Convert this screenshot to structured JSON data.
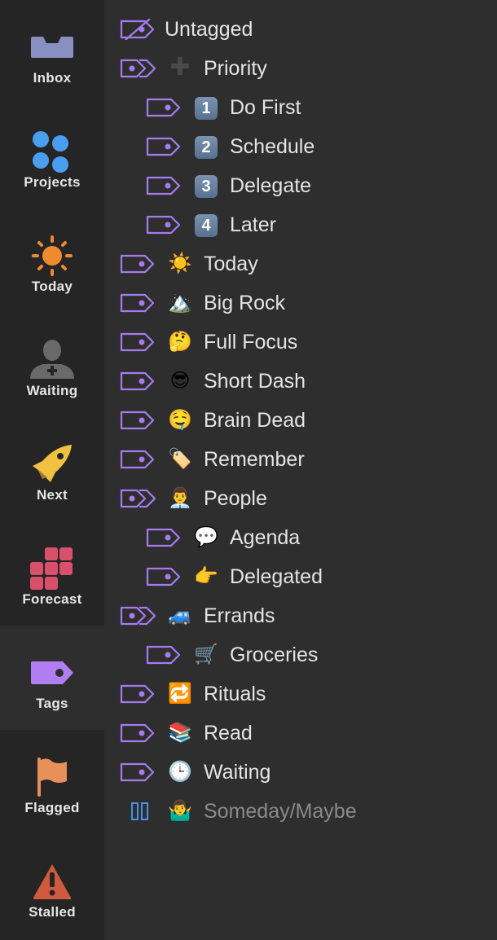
{
  "sidebar": {
    "items": [
      {
        "label": "Inbox",
        "icon": "inbox-icon",
        "color": "#8a8fc2"
      },
      {
        "label": "Projects",
        "icon": "projects-icon",
        "color": "#4a9ef0"
      },
      {
        "label": "Today",
        "icon": "sun-icon",
        "color": "#f08a30"
      },
      {
        "label": "Waiting",
        "icon": "person-plus-icon",
        "color": "#6a6a6a"
      },
      {
        "label": "Next",
        "icon": "rocket-icon",
        "color": "#f0c040"
      },
      {
        "label": "Forecast",
        "icon": "forecast-grid-icon",
        "color": "#d8506a"
      },
      {
        "label": "Tags",
        "icon": "tag-icon",
        "color": "#b07ef0",
        "selected": true
      },
      {
        "label": "Flagged",
        "icon": "flag-icon",
        "color": "#e8905a"
      },
      {
        "label": "Stalled",
        "icon": "warning-icon",
        "color": "#d05a40"
      }
    ]
  },
  "tags": {
    "accent": "#a77bf0",
    "dropped_color": "#4a8fe8",
    "items": [
      {
        "label": "Untagged",
        "emoji": "",
        "level": 0,
        "kind": "untagged"
      },
      {
        "label": "Priority",
        "emoji": "➕",
        "level": 0,
        "kind": "group"
      },
      {
        "label": "Do First",
        "emoji": "1",
        "level": 1,
        "kind": "tag",
        "keycap": true
      },
      {
        "label": "Schedule",
        "emoji": "2",
        "level": 1,
        "kind": "tag",
        "keycap": true
      },
      {
        "label": "Delegate",
        "emoji": "3",
        "level": 1,
        "kind": "tag",
        "keycap": true
      },
      {
        "label": "Later",
        "emoji": "4",
        "level": 1,
        "kind": "tag",
        "keycap": true
      },
      {
        "label": "Today",
        "emoji": "☀️",
        "level": 0,
        "kind": "tag"
      },
      {
        "label": "Big Rock",
        "emoji": "🏔️",
        "level": 0,
        "kind": "tag"
      },
      {
        "label": "Full Focus",
        "emoji": "🤔",
        "level": 0,
        "kind": "tag"
      },
      {
        "label": "Short Dash",
        "emoji": "😎",
        "level": 0,
        "kind": "tag"
      },
      {
        "label": "Brain Dead",
        "emoji": "🤤",
        "level": 0,
        "kind": "tag"
      },
      {
        "label": "Remember",
        "emoji": "🏷️",
        "level": 0,
        "kind": "tag"
      },
      {
        "label": "People",
        "emoji": "👨‍💼",
        "level": 0,
        "kind": "group"
      },
      {
        "label": "Agenda",
        "emoji": "💬",
        "level": 1,
        "kind": "tag"
      },
      {
        "label": "Delegated",
        "emoji": "👉",
        "level": 1,
        "kind": "tag"
      },
      {
        "label": "Errands",
        "emoji": "🚙",
        "level": 0,
        "kind": "group"
      },
      {
        "label": "Groceries",
        "emoji": "🛒",
        "level": 1,
        "kind": "tag"
      },
      {
        "label": "Rituals",
        "emoji": "🔁",
        "level": 0,
        "kind": "tag"
      },
      {
        "label": "Read",
        "emoji": "📚",
        "level": 0,
        "kind": "tag"
      },
      {
        "label": "Waiting",
        "emoji": "🕒",
        "level": 0,
        "kind": "tag"
      },
      {
        "label": "Someday/Maybe",
        "emoji": "🤷‍♂️",
        "level": 0,
        "kind": "on-hold"
      }
    ]
  }
}
